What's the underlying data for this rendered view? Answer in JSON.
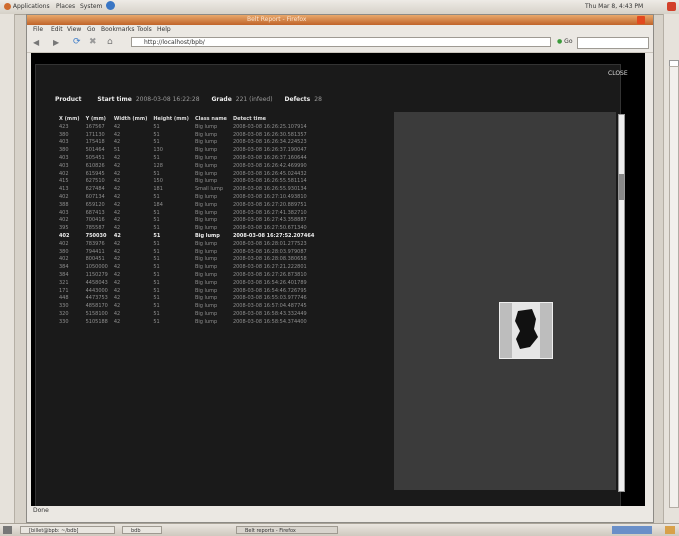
{
  "top_panel": {
    "menus": [
      "Applications",
      "Places",
      "System"
    ],
    "clock": "Thu Mar 8, 4:43 PM"
  },
  "window": {
    "title": "Belt Report - Firefox"
  },
  "menubar": [
    "File",
    "Edit",
    "View",
    "Go",
    "Bookmarks",
    "Tools",
    "Help"
  ],
  "urlbar": {
    "value": "http://localhost/bpb/",
    "go_label": "Go"
  },
  "dialog": {
    "close_label": "CLOSE",
    "info": [
      {
        "label": "Product",
        "value": ""
      },
      {
        "label": "Start time",
        "value": "2008-03-08 16:22:28"
      },
      {
        "label": "Grade",
        "value": "221 (infeed)"
      },
      {
        "label": "Defects",
        "value": "28"
      }
    ],
    "columns": [
      "X (mm)",
      "Y (mm)",
      "Width (mm)",
      "Height (mm)",
      "Class name",
      "Detect time"
    ],
    "rows": [
      [
        "423",
        "167567",
        "42",
        "51",
        "Big lump",
        "2008-03-08 16:26:25.107914"
      ],
      [
        "380",
        "171130",
        "42",
        "51",
        "Big lump",
        "2008-03-08 16:26:30.581357"
      ],
      [
        "403",
        "175418",
        "42",
        "51",
        "Big lump",
        "2008-03-08 16:26:34.224523"
      ],
      [
        "380",
        "501464",
        "51",
        "130",
        "Big lump",
        "2008-03-08 16:26:37.190047"
      ],
      [
        "403",
        "505451",
        "42",
        "51",
        "Big lump",
        "2008-03-08 16:26:37.160644"
      ],
      [
        "403",
        "610826",
        "42",
        "128",
        "Big lump",
        "2008-03-08 16:26:42.469990"
      ],
      [
        "402",
        "615945",
        "42",
        "51",
        "Big lump",
        "2008-03-08 16:26:45.024432"
      ],
      [
        "415",
        "627510",
        "42",
        "150",
        "Big lump",
        "2008-03-08 16:26:55.581114"
      ],
      [
        "413",
        "627484",
        "42",
        "181",
        "Small lump",
        "2008-03-08 16:26:55.930134"
      ],
      [
        "402",
        "607134",
        "42",
        "51",
        "Big lump",
        "2008-03-08 16:27:10.493810"
      ],
      [
        "388",
        "659120",
        "42",
        "184",
        "Big lump",
        "2008-03-08 16:27:20.889751"
      ],
      [
        "403",
        "687413",
        "42",
        "51",
        "Big lump",
        "2008-03-08 16:27:41.382710"
      ],
      [
        "402",
        "700416",
        "42",
        "51",
        "Big lump",
        "2008-03-08 16:27:43.358887"
      ],
      [
        "395",
        "785587",
        "42",
        "51",
        "Big lump",
        "2008-03-08 16:27:50.671340"
      ],
      [
        "402",
        "750030",
        "42",
        "51",
        "Big lump",
        "2008-03-08 16:27:52.207464"
      ],
      [
        "402",
        "783976",
        "42",
        "51",
        "Big lump",
        "2008-03-08 16:28:01.277523"
      ],
      [
        "380",
        "794411",
        "42",
        "51",
        "Big lump",
        "2008-03-08 16:28:03.979087"
      ],
      [
        "402",
        "800451",
        "42",
        "51",
        "Big lump",
        "2008-03-08 16:28:08.380658"
      ],
      [
        "384",
        "1050000",
        "42",
        "51",
        "Big lump",
        "2008-03-08 16:27:21.222801"
      ],
      [
        "384",
        "1150279",
        "42",
        "51",
        "Big lump",
        "2008-03-08 16:27:26.873810"
      ],
      [
        "321",
        "4458043",
        "42",
        "51",
        "Big lump",
        "2008-03-08 16:54:26.401789"
      ],
      [
        "171",
        "4443000",
        "42",
        "51",
        "Big lump",
        "2008-03-08 16:54:46.726795"
      ],
      [
        "448",
        "4473753",
        "42",
        "51",
        "Big lump",
        "2008-03-08 16:55:03.977746"
      ],
      [
        "330",
        "4858170",
        "42",
        "51",
        "Big lump",
        "2008-03-08 16:57:04.487745"
      ],
      [
        "320",
        "5158100",
        "42",
        "51",
        "Big lump",
        "2008-03-08 16:58:43.332449"
      ],
      [
        "330",
        "5105188",
        "42",
        "51",
        "Big lump",
        "2008-03-08 16:58:54.374400"
      ]
    ],
    "highlight_row": 14
  },
  "status_text": "Done",
  "taskbar": {
    "tasks": [
      "[billet@bpb: ~/bdb]",
      "bdb",
      "Belt reports - Firefox"
    ]
  },
  "colors": {
    "titlebar": "#c0642a",
    "content_bg": "#000000",
    "panel_bg": "#3b3b3b"
  }
}
